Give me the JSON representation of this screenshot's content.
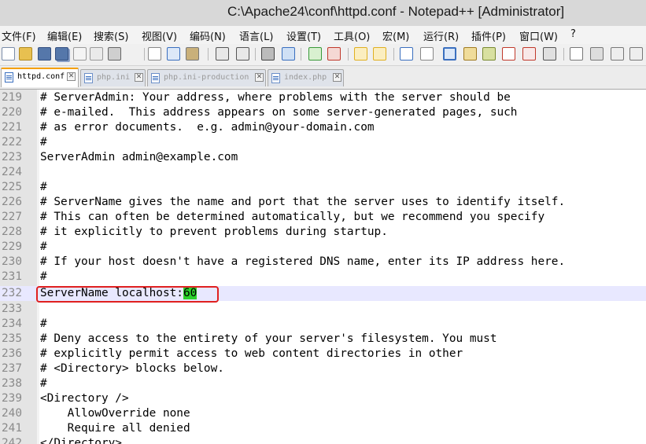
{
  "window": {
    "title": "C:\\Apache24\\conf\\httpd.conf - Notepad++ [Administrator]"
  },
  "menu": {
    "items": [
      "文件(F)",
      "编辑(E)",
      "搜索(S)",
      "视图(V)",
      "编码(N)",
      "语言(L)",
      "设置(T)",
      "工具(O)",
      "宏(M)",
      "运行(R)",
      "插件(P)",
      "窗口(W)",
      "?"
    ]
  },
  "toolbar": {
    "icons": [
      "new-file-icon",
      "open-file-icon",
      "save-icon",
      "save-all-icon",
      "close-icon",
      "close-all-icon",
      "print-icon",
      "cut-icon",
      "copy-icon",
      "paste-icon",
      "undo-icon",
      "redo-icon",
      "find-icon",
      "replace-icon",
      "zoom-in-icon",
      "zoom-out-icon",
      "sync-vertical-icon",
      "sync-horizontal-icon",
      "word-wrap-icon",
      "show-all-chars-icon",
      "indent-guide-icon",
      "udl-icon",
      "doc-map-icon",
      "function-list-icon",
      "folder-workspace-icon",
      "monitoring-icon",
      "record-macro-icon",
      "stop-macro-icon",
      "play-macro-icon",
      "run-macro-icon"
    ],
    "colors": {
      "accent_blue": "#3a6fbf",
      "accent_green": "#3a9a3a",
      "accent_red": "#c0392b",
      "accent_yellow": "#e0b020"
    }
  },
  "tabs": [
    {
      "label": "httpd.conf",
      "active": true
    },
    {
      "label": "php.ini",
      "active": false
    },
    {
      "label": "php.ini-production",
      "active": false
    },
    {
      "label": "index.php",
      "active": false
    }
  ],
  "editor": {
    "current_line": 232,
    "highlight_text": "60",
    "highlight_color": "#2bd22b",
    "callout_color": "#e02020",
    "lines": [
      {
        "num": "219",
        "text": "# ServerAdmin: Your address, where problems with the server should be"
      },
      {
        "num": "220",
        "text": "# e-mailed.  This address appears on some server-generated pages, such"
      },
      {
        "num": "221",
        "text": "# as error documents.  e.g. admin@your-domain.com"
      },
      {
        "num": "222",
        "text": "#"
      },
      {
        "num": "223",
        "text": "ServerAdmin admin@example.com"
      },
      {
        "num": "224",
        "text": ""
      },
      {
        "num": "225",
        "text": "#"
      },
      {
        "num": "226",
        "text": "# ServerName gives the name and port that the server uses to identify itself."
      },
      {
        "num": "227",
        "text": "# This can often be determined automatically, but we recommend you specify"
      },
      {
        "num": "228",
        "text": "# it explicitly to prevent problems during startup."
      },
      {
        "num": "229",
        "text": "#"
      },
      {
        "num": "230",
        "text": "# If your host doesn't have a registered DNS name, enter its IP address here."
      },
      {
        "num": "231",
        "text": "#"
      },
      {
        "num": "232",
        "text_before": "ServerName localhost:",
        "text_hl": "60"
      },
      {
        "num": "233",
        "text": ""
      },
      {
        "num": "234",
        "text": "#"
      },
      {
        "num": "235",
        "text": "# Deny access to the entirety of your server's filesystem. You must"
      },
      {
        "num": "236",
        "text": "# explicitly permit access to web content directories in other"
      },
      {
        "num": "237",
        "text": "# <Directory> blocks below."
      },
      {
        "num": "238",
        "text": "#"
      },
      {
        "num": "239",
        "text": "<Directory />"
      },
      {
        "num": "240",
        "text": "    AllowOverride none"
      },
      {
        "num": "241",
        "text": "    Require all denied"
      },
      {
        "num": "242",
        "text": "</Directory>"
      }
    ]
  }
}
